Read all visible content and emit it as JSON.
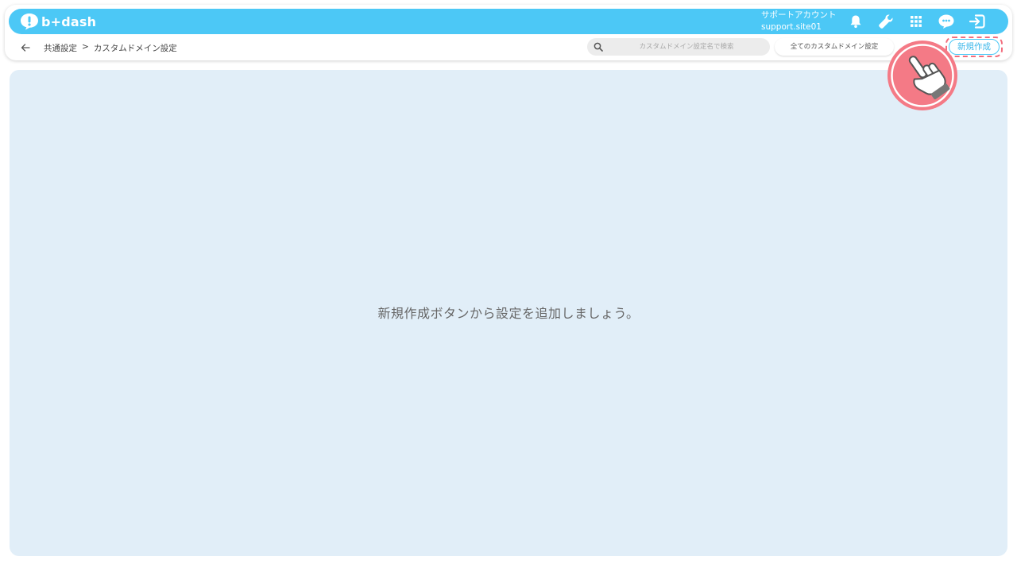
{
  "header": {
    "logo_text": "b+dash",
    "account_name": "サポートアカウント",
    "account_id": "support.site01",
    "icons": [
      "bell-icon",
      "wrench-icon",
      "apps-grid-icon",
      "chat-icon",
      "logout-icon"
    ],
    "brand_color": "#4cc8f6"
  },
  "subbar": {
    "breadcrumb": [
      "共通設定",
      ">",
      "カスタムドメイン設定"
    ],
    "search_placeholder": "カスタムドメイン設定名で検索",
    "filter_label": "全てのカスタムドメイン設定",
    "new_button_label": "新規作成"
  },
  "main": {
    "empty_message": "新規作成ボタンから設定を追加しましょう。",
    "background_color": "#e1eef8"
  },
  "annotation": {
    "highlight_color": "#f26d7d",
    "icon": "pointing-hand-icon"
  }
}
